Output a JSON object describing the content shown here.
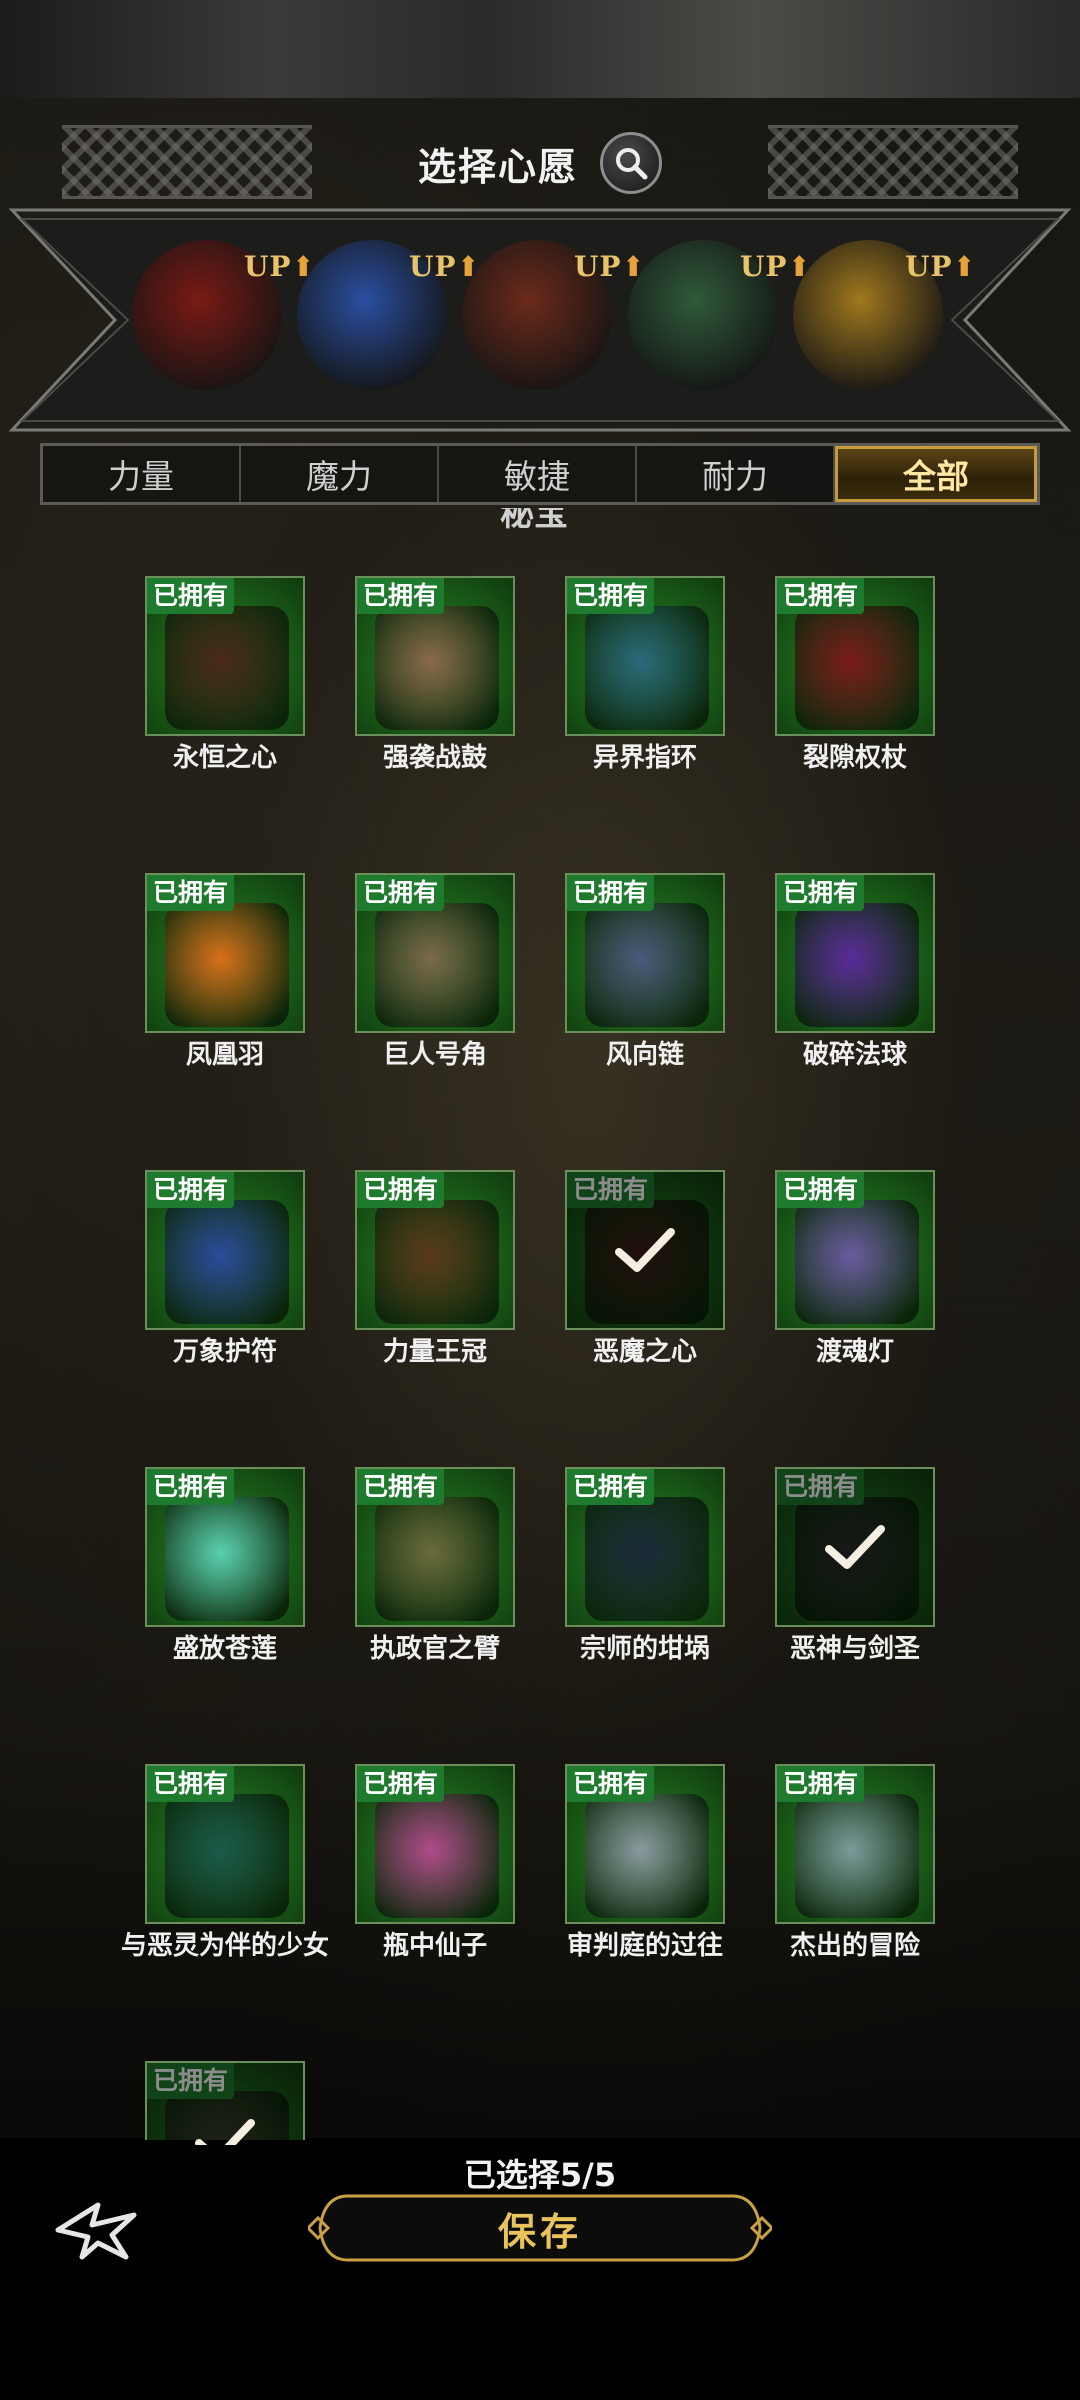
{
  "header": {
    "title": "选择心愿",
    "search_icon": "search-icon"
  },
  "featured": [
    {
      "name": "featured-1",
      "badge": "UP",
      "color": "#7a1a14"
    },
    {
      "name": "featured-2",
      "badge": "UP",
      "color": "#2a4fa0"
    },
    {
      "name": "featured-3",
      "badge": "UP",
      "color": "#6b2a1a"
    },
    {
      "name": "featured-4",
      "badge": "UP",
      "color": "#2f5a3a"
    },
    {
      "name": "featured-5",
      "badge": "UP",
      "color": "#a0781e"
    }
  ],
  "tabs": [
    {
      "label": "力量",
      "active": false
    },
    {
      "label": "魔力",
      "active": false
    },
    {
      "label": "敏捷",
      "active": false
    },
    {
      "label": "耐力",
      "active": false
    },
    {
      "label": "全部",
      "active": true
    }
  ],
  "section_title": "秘宝",
  "owned_label": "已拥有",
  "items": [
    {
      "name": "永恒之心",
      "color": "#4a2a18",
      "selected": false
    },
    {
      "name": "强袭战鼓",
      "color": "#8a6a4a",
      "selected": false
    },
    {
      "name": "异界指环",
      "color": "#2a6a7a",
      "selected": false
    },
    {
      "name": "裂隙权杖",
      "color": "#7a1a1a",
      "selected": false
    },
    {
      "name": "凤凰羽",
      "color": "#d8701a",
      "selected": false
    },
    {
      "name": "巨人号角",
      "color": "#7a6a4a",
      "selected": false
    },
    {
      "name": "风向链",
      "color": "#4a5a7a",
      "selected": false
    },
    {
      "name": "破碎法球",
      "color": "#5a2a9a",
      "selected": false
    },
    {
      "name": "万象护符",
      "color": "#2a4a9a",
      "selected": false
    },
    {
      "name": "力量王冠",
      "color": "#5a3a1a",
      "selected": false
    },
    {
      "name": "恶魔之心",
      "color": "#3a1a14",
      "selected": true
    },
    {
      "name": "渡魂灯",
      "color": "#6a5aa0",
      "selected": false
    },
    {
      "name": "盛放苍莲",
      "color": "#5ad0b0",
      "selected": false
    },
    {
      "name": "执政官之臂",
      "color": "#6a6a3a",
      "selected": false
    },
    {
      "name": "宗师的坩埚",
      "color": "#1a2a3a",
      "selected": false
    },
    {
      "name": "恶神与剑圣",
      "color": "#2a2a2a",
      "selected": true
    },
    {
      "name": "与恶灵为伴的少女",
      "color": "#1a5a4a",
      "selected": false
    },
    {
      "name": "瓶中仙子",
      "color": "#b04a8a",
      "selected": false
    },
    {
      "name": "审判庭的过往",
      "color": "#8a9aa0",
      "selected": false
    },
    {
      "name": "杰出的冒险",
      "color": "#7a9a9a",
      "selected": false
    },
    {
      "name": "",
      "color": "#3a3a2a",
      "selected": true
    }
  ],
  "footer": {
    "selected_text": "已选择5/5",
    "save_label": "保存",
    "back_icon": "back-icon"
  }
}
